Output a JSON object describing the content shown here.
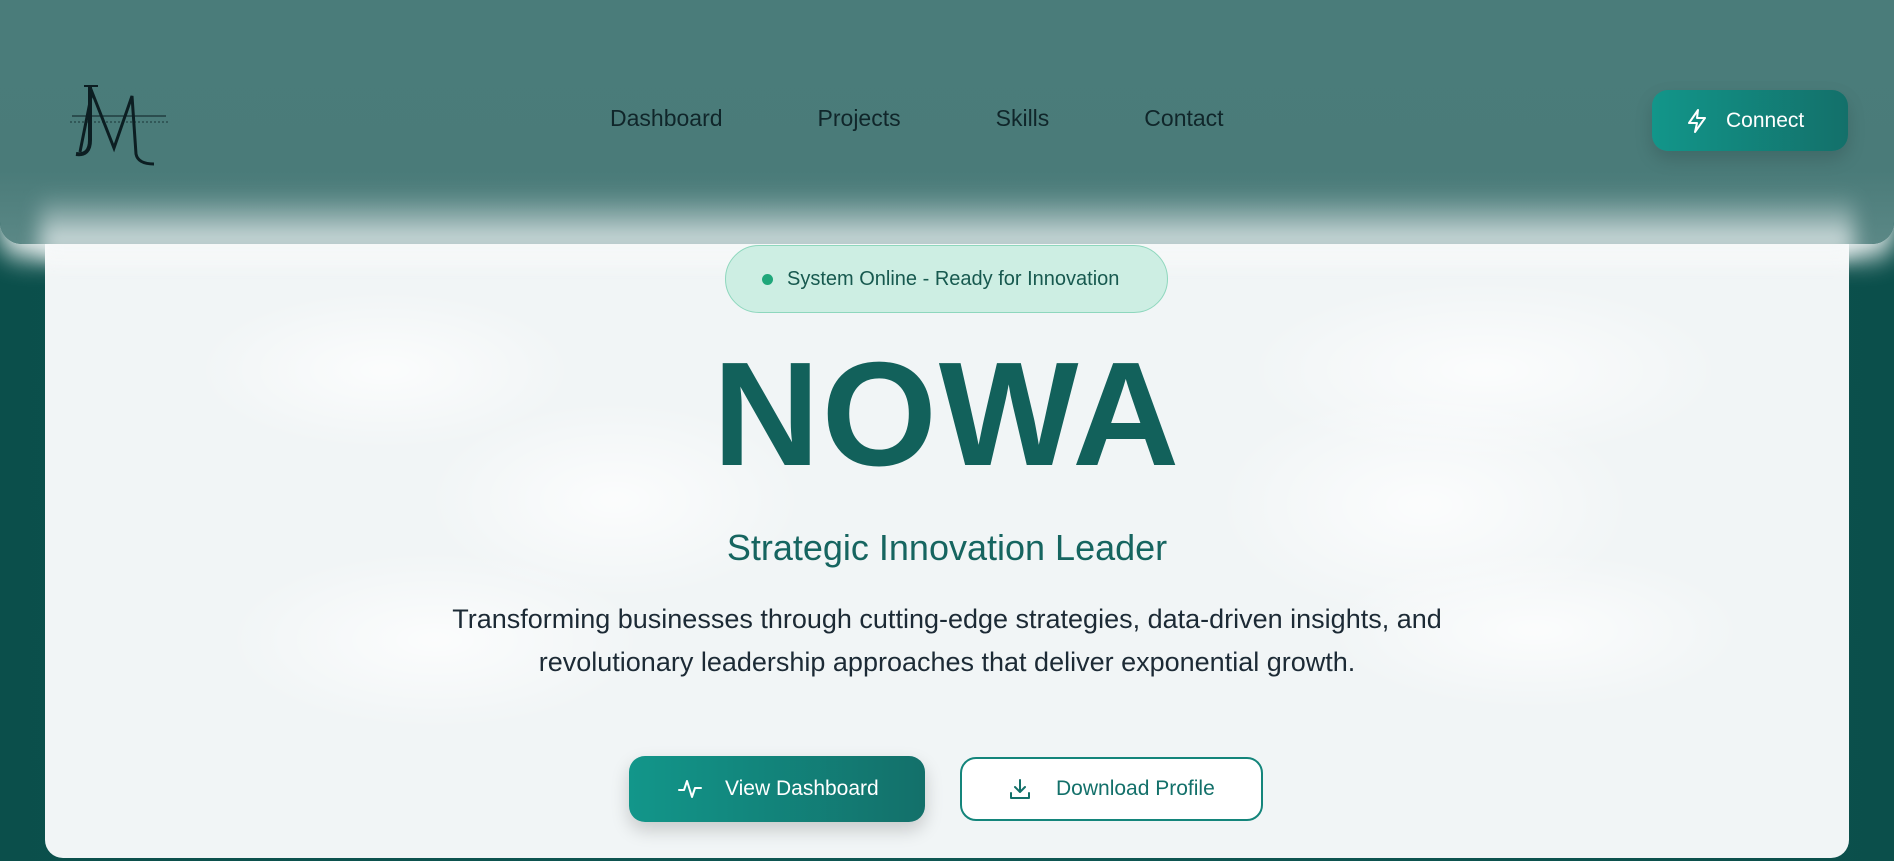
{
  "header": {
    "logo_text": "JM",
    "nav": [
      {
        "label": "Dashboard"
      },
      {
        "label": "Projects"
      },
      {
        "label": "Skills"
      },
      {
        "label": "Contact"
      }
    ],
    "connect_label": "Connect",
    "connect_icon": "lightning-icon"
  },
  "hero": {
    "status": "System Online - Ready for Innovation",
    "title": "NOWA",
    "subtitle": "Strategic Innovation Leader",
    "description": "Transforming businesses through cutting-edge strategies, data-driven insights, and revolutionary leadership approaches that deliver exponential growth.",
    "primary_button": {
      "label": "View Dashboard",
      "icon": "activity-icon"
    },
    "secondary_button": {
      "label": "Download Profile",
      "icon": "download-icon"
    }
  },
  "colors": {
    "header_bg": "#4a7b79",
    "accent": "#12968a",
    "title": "#12615b",
    "status_dot": "#1fa77a",
    "background": "#0d4d4a"
  }
}
